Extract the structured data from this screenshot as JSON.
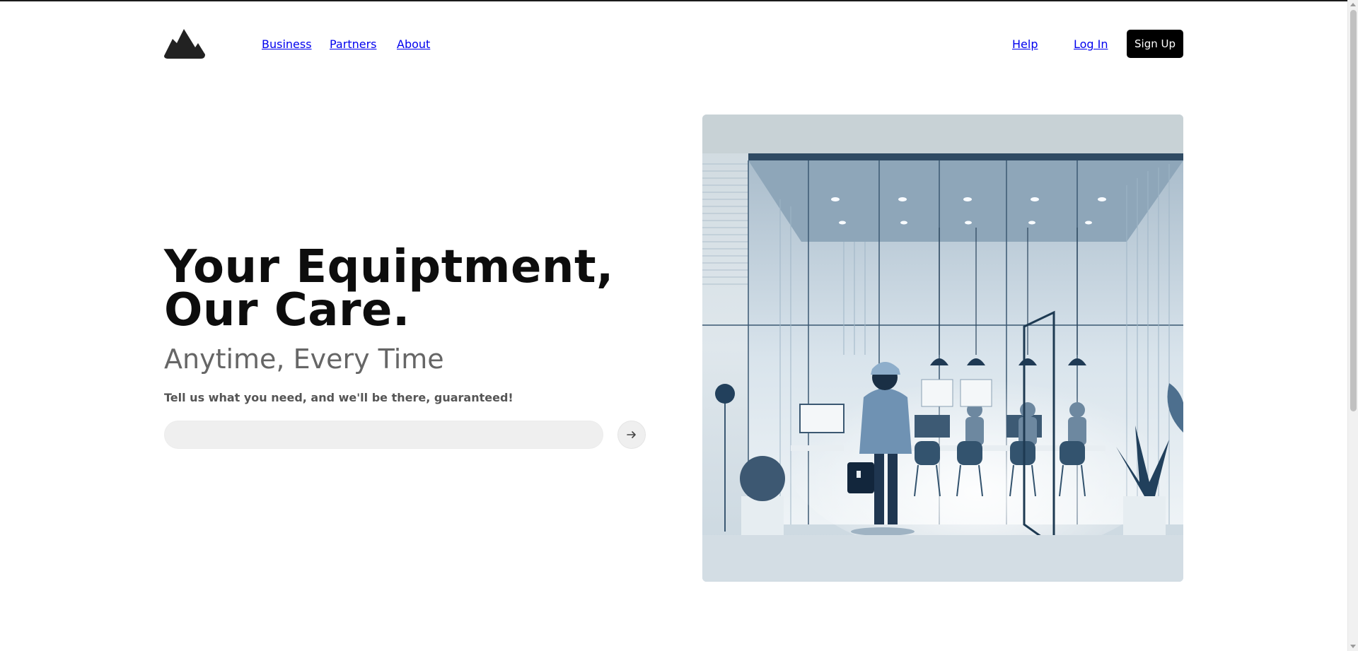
{
  "header": {
    "logo_icon": "mountain-logo-icon",
    "nav": {
      "business": "Business",
      "partners": "Partners",
      "about": "About",
      "help": "Help",
      "login": "Log In",
      "signup": "Sign Up"
    }
  },
  "hero": {
    "title": "Your Equiptment, Our Care.",
    "subtitle": "Anytime, Every Time",
    "description": "Tell us what you need, and we'll be there, guaranteed!",
    "search": {
      "value": "",
      "placeholder": "",
      "submit_icon": "arrow-right-icon"
    },
    "image_icon": "office-technician-illustration"
  },
  "colors": {
    "primary": "#000000",
    "input_bg": "#efefef",
    "subtitle": "#666666",
    "illustration_blue": "#5f7f9f"
  }
}
